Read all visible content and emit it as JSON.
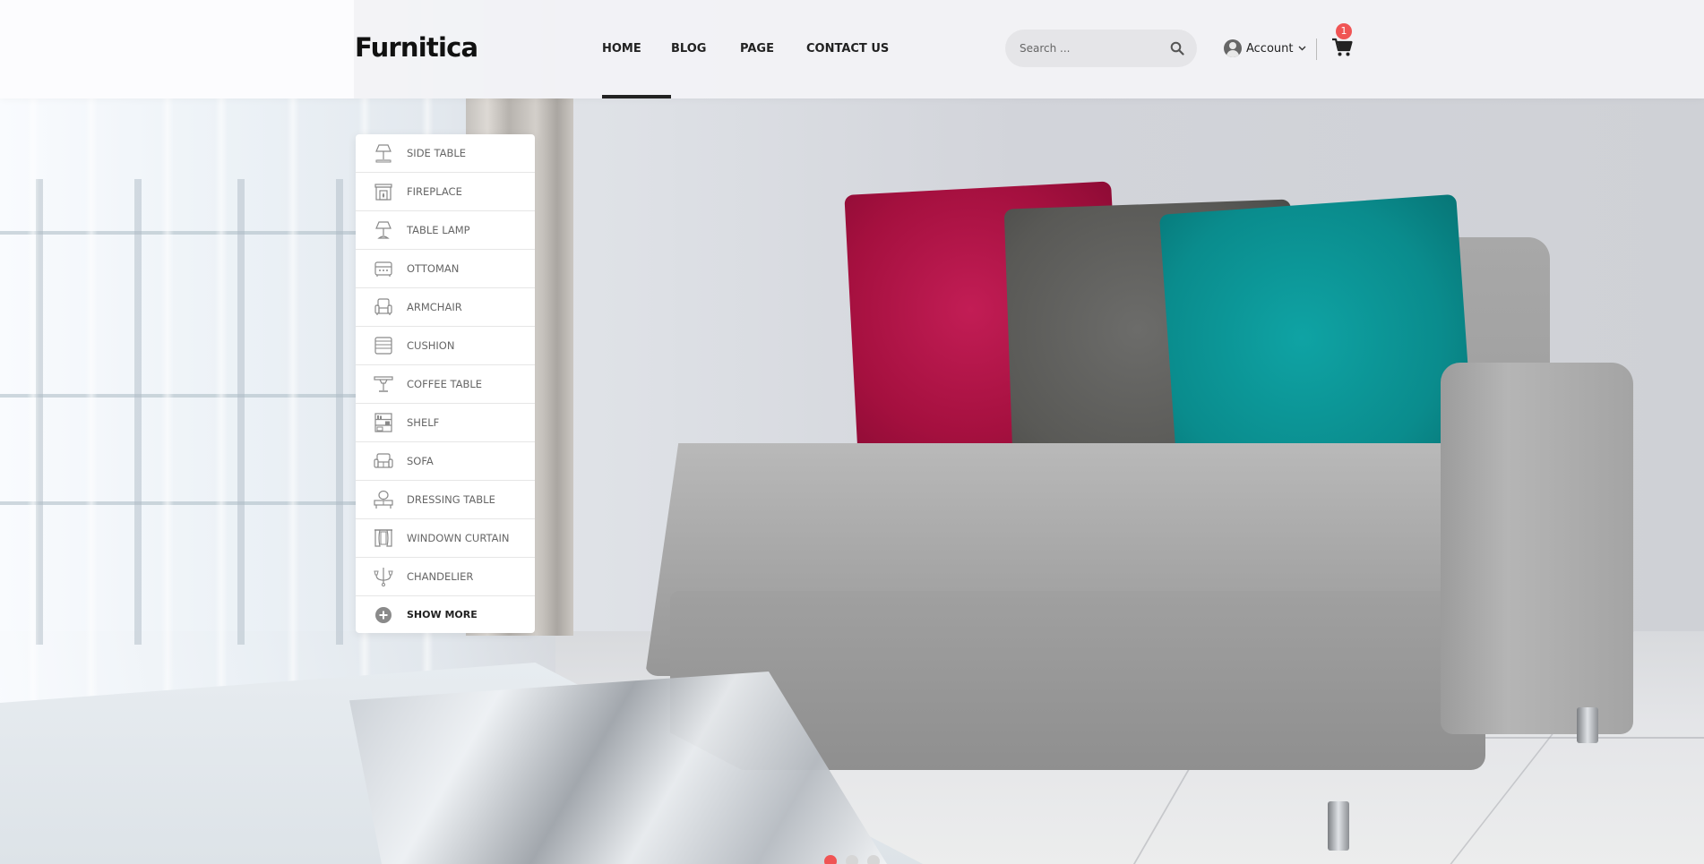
{
  "brand": {
    "logo_text": "Furnitica"
  },
  "nav": {
    "items": [
      {
        "label": "HOME",
        "active": true
      },
      {
        "label": "BLOG",
        "active": false
      },
      {
        "label": "PAGE",
        "active": false
      },
      {
        "label": "CONTACT US",
        "active": false
      }
    ]
  },
  "search": {
    "placeholder": "Search ...",
    "value": ""
  },
  "account": {
    "label": "Account"
  },
  "cart": {
    "count": "1"
  },
  "categories": {
    "items": [
      {
        "label": "SIDE TABLE",
        "icon": "side-table-icon"
      },
      {
        "label": "FIREPLACE",
        "icon": "fireplace-icon"
      },
      {
        "label": "TABLE LAMP",
        "icon": "table-lamp-icon"
      },
      {
        "label": "OTTOMAN",
        "icon": "ottoman-icon"
      },
      {
        "label": "ARMCHAIR",
        "icon": "armchair-icon"
      },
      {
        "label": "CUSHION",
        "icon": "cushion-icon"
      },
      {
        "label": "COFFEE TABLE",
        "icon": "coffee-table-icon"
      },
      {
        "label": "SHELF",
        "icon": "shelf-icon"
      },
      {
        "label": "SOFA",
        "icon": "sofa-icon"
      },
      {
        "label": "DRESSING TABLE",
        "icon": "dressing-table-icon"
      },
      {
        "label": "WINDOWN CURTAIN",
        "icon": "window-curtain-icon"
      },
      {
        "label": "CHANDELIER",
        "icon": "chandelier-icon"
      }
    ],
    "show_more": "SHOW MORE"
  },
  "slider": {
    "slide_count": 3,
    "active_index": 0
  },
  "colors": {
    "accent": "#f05454",
    "text": "#222222",
    "menu_text": "#666666"
  }
}
